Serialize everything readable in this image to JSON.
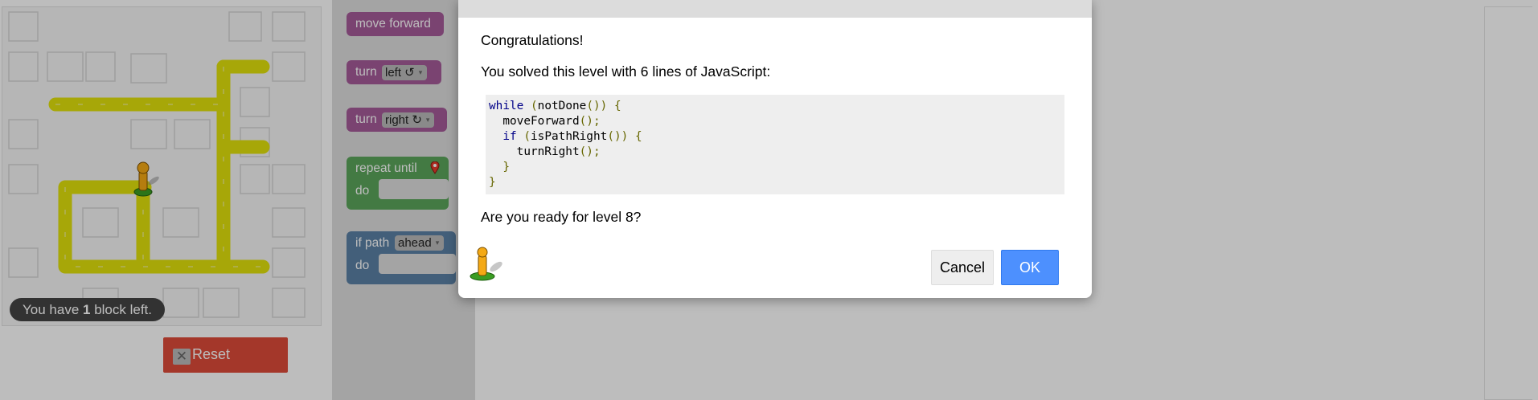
{
  "maze": {
    "capacity_prefix": "You have ",
    "capacity_count": "1",
    "capacity_suffix": " block left."
  },
  "reset": {
    "icon": "close-icon",
    "label": "Reset"
  },
  "toolbox": {
    "move_forward": "move forward",
    "turn_left": {
      "label": "turn",
      "option": "left ↺"
    },
    "turn_right": {
      "label": "turn",
      "option": "right ↻"
    },
    "repeat_until": {
      "label": "repeat until",
      "do": "do",
      "icon": "map-marker-icon"
    },
    "if_path": {
      "label": "if path",
      "option": "ahead",
      "do": "do"
    },
    "caret": "▾"
  },
  "dialog": {
    "congrats": "Congratulations!",
    "solved": "You solved this level with 6 lines of JavaScript:",
    "ready": "Are you ready for level 8?",
    "cancel": "Cancel",
    "ok": "OK",
    "mascot_icon": "pegman-icon",
    "code": [
      [
        {
          "t": "kw",
          "v": "while"
        },
        {
          "t": "",
          "v": " "
        },
        {
          "t": "pn",
          "v": "("
        },
        {
          "t": "",
          "v": "notDone"
        },
        {
          "t": "pn",
          "v": "())"
        },
        {
          "t": "",
          "v": " "
        },
        {
          "t": "pn",
          "v": "{"
        }
      ],
      [
        {
          "t": "",
          "v": "  moveForward"
        },
        {
          "t": "pn",
          "v": "();"
        }
      ],
      [
        {
          "t": "",
          "v": "  "
        },
        {
          "t": "kw",
          "v": "if"
        },
        {
          "t": "",
          "v": " "
        },
        {
          "t": "pn",
          "v": "("
        },
        {
          "t": "",
          "v": "isPathRight"
        },
        {
          "t": "pn",
          "v": "())"
        },
        {
          "t": "",
          "v": " "
        },
        {
          "t": "pn",
          "v": "{"
        }
      ],
      [
        {
          "t": "",
          "v": "    turnRight"
        },
        {
          "t": "pn",
          "v": "();"
        }
      ],
      [
        {
          "t": "",
          "v": "  "
        },
        {
          "t": "pn",
          "v": "}"
        }
      ],
      [
        {
          "t": "pn",
          "v": "}"
        }
      ]
    ]
  },
  "colors": {
    "path": "#e2e20b",
    "motion_block": "#a55b99",
    "loop_block": "#5ba55b",
    "logic_block": "#5b80a5",
    "reset_button": "#dd4b39",
    "ok_button": "#4d90fe"
  }
}
